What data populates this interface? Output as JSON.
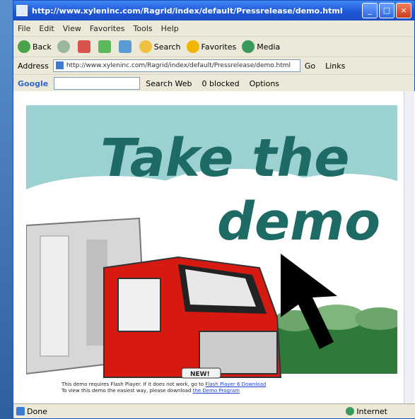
{
  "window": {
    "title": "http://www.xyleninc.com/Ragrid/index/default/Pressrelease/demo.html",
    "controls": [
      "_",
      "□",
      "×"
    ]
  },
  "menu": [
    "File",
    "Edit",
    "View",
    "Favorites",
    "Tools",
    "Help"
  ],
  "toolbar": {
    "back": "Back",
    "search": "Search",
    "favorites": "Favorites",
    "media": "Media"
  },
  "address": {
    "label": "Address",
    "url": "http://www.xyleninc.com/Ragrid/index/default/Pressrelease/demo.html",
    "go": "Go",
    "links": "Links"
  },
  "google_bar": {
    "label": "Google",
    "search_web": "Search Web",
    "blocked": "0 blocked",
    "options": "Options"
  },
  "banner": {
    "line1": "Take the",
    "line2": "demo",
    "badge": "NEW!",
    "colors": {
      "sky": "#9bd1d0",
      "text": "#1e6b66",
      "truck": "#d61a12"
    }
  },
  "caption": {
    "text": "This demo requires Flash Player. If it does not work, go to",
    "link1": "Flash Player 6 Download",
    "text2": "To view this demo the easiest way, please download",
    "link2": "the Demo Program"
  },
  "status": {
    "left": "Done",
    "right": "Internet"
  }
}
